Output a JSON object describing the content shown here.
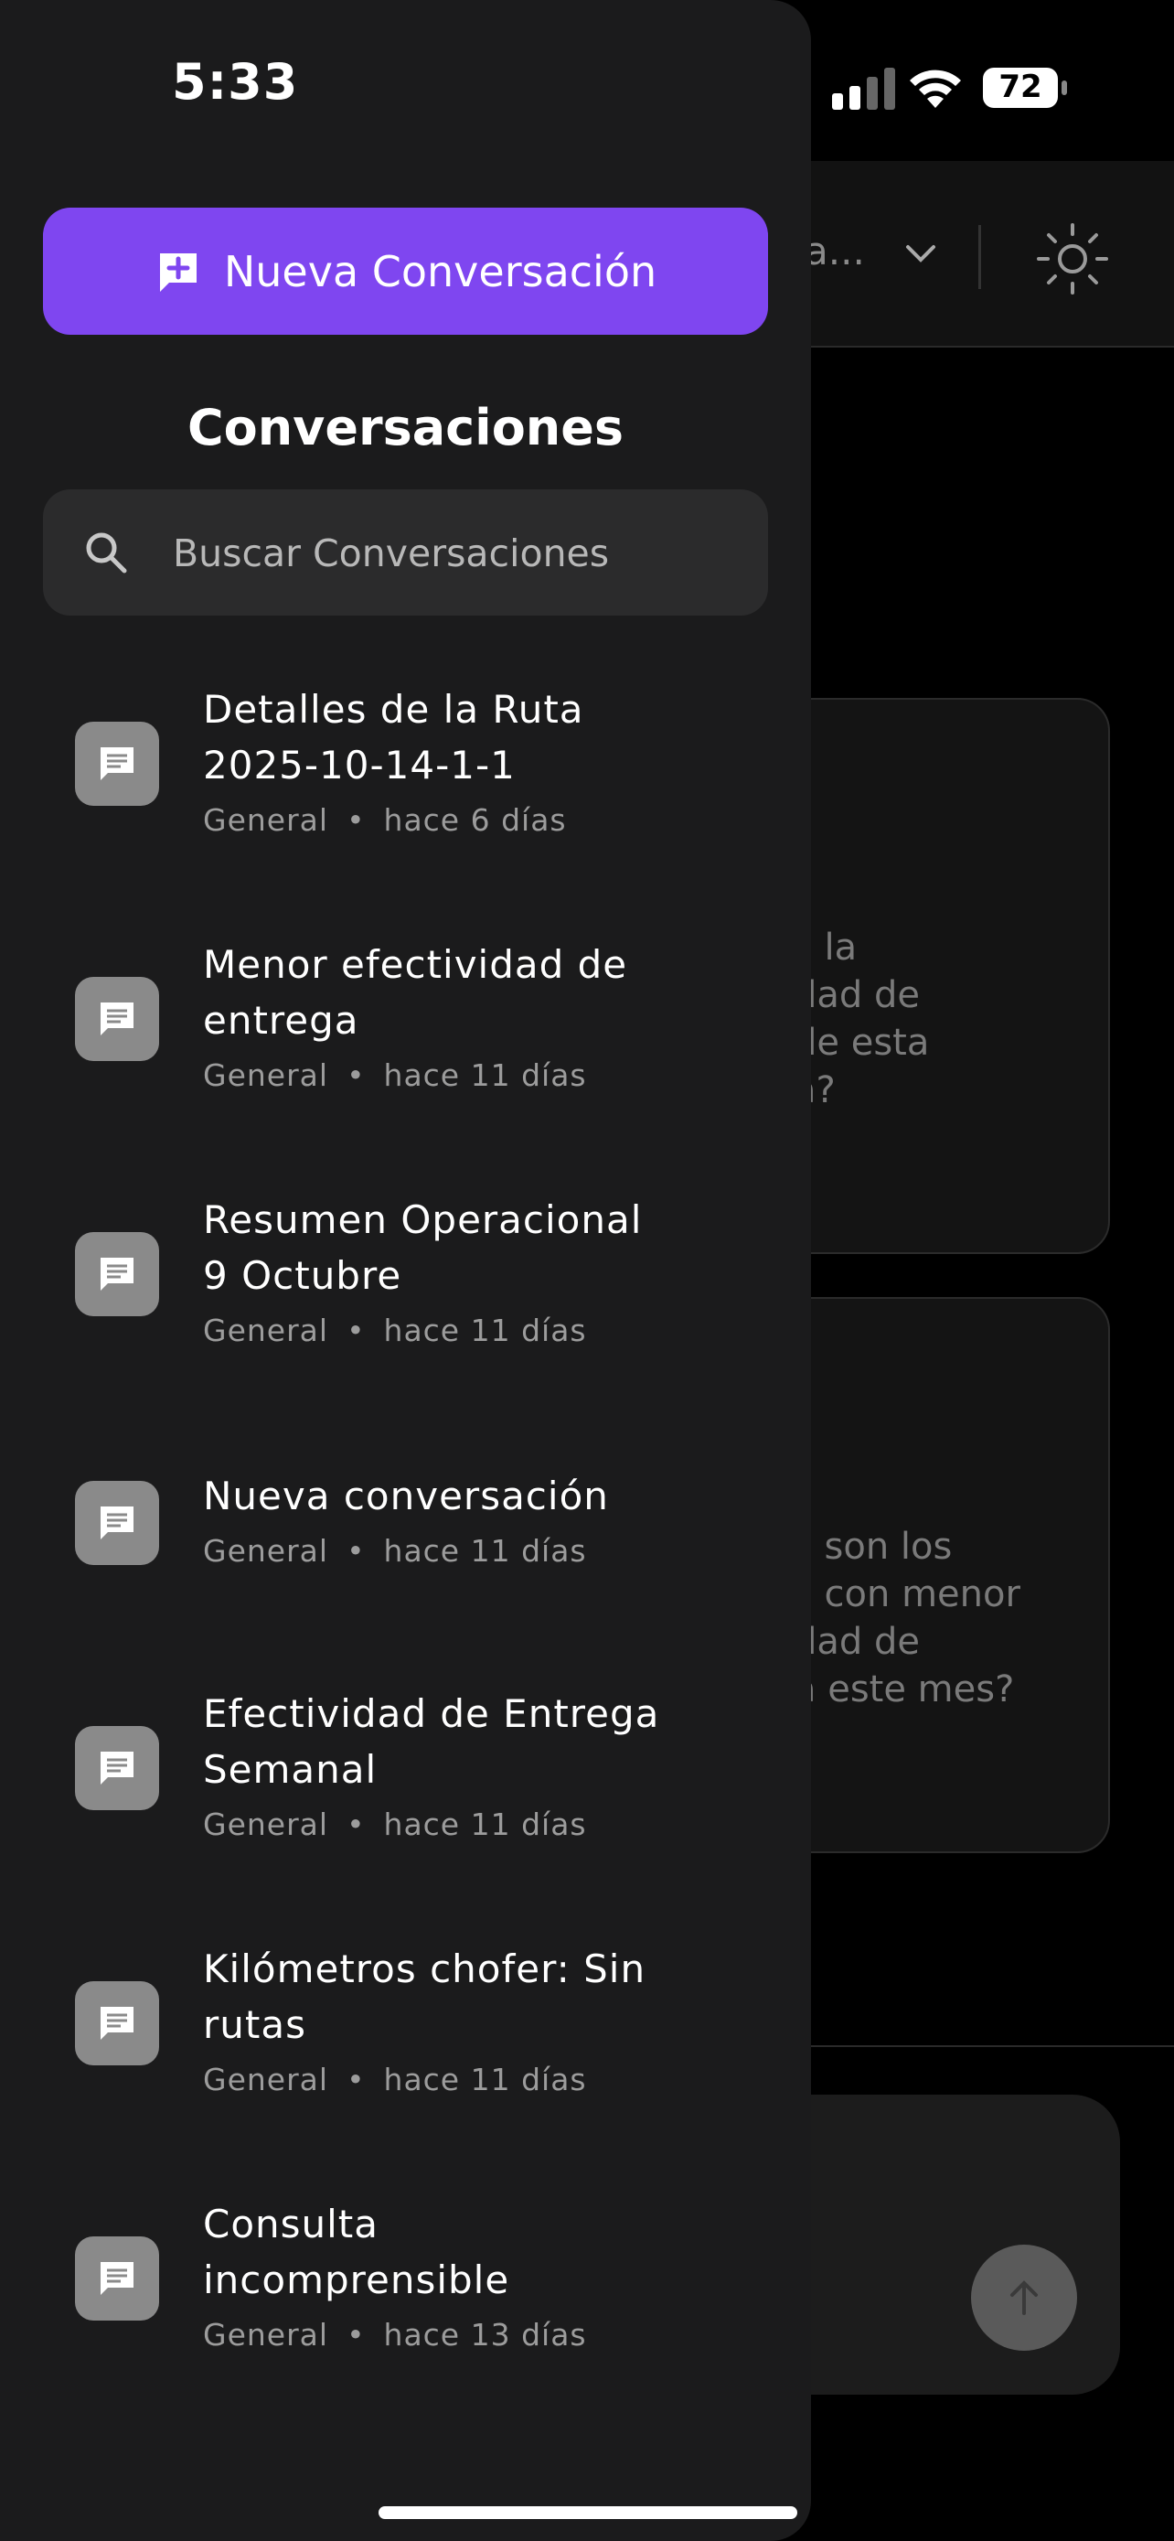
{
  "status_bar": {
    "time": "5:33",
    "battery": "72"
  },
  "background": {
    "model_selector": "a...",
    "cards": [
      {
        "lines": [
          "s la",
          "dad de",
          "de esta",
          "a?"
        ]
      },
      {
        "lines": [
          "s son los",
          "s con menor",
          "dad de",
          "a este mes?"
        ]
      }
    ]
  },
  "drawer": {
    "new_button_label": "Nueva Conversación",
    "title": "Conversaciones",
    "search_placeholder": "Buscar Conversaciones",
    "conversations": [
      {
        "title_lines": [
          "Detalles de la Ruta",
          "2025-10-14-1-1"
        ],
        "category": "General",
        "time": "hace 6 días"
      },
      {
        "title_lines": [
          "Menor efectividad de",
          "entrega"
        ],
        "category": "General",
        "time": "hace 11 días"
      },
      {
        "title_lines": [
          "Resumen Operacional",
          "9 Octubre"
        ],
        "category": "General",
        "time": "hace 11 días"
      },
      {
        "title_lines": [
          "Nueva conversación"
        ],
        "category": "General",
        "time": "hace 11 días"
      },
      {
        "title_lines": [
          "Efectividad de Entrega",
          "Semanal"
        ],
        "category": "General",
        "time": "hace 11 días"
      },
      {
        "title_lines": [
          "Kilómetros chofer: Sin",
          "rutas"
        ],
        "category": "General",
        "time": "hace 11 días"
      },
      {
        "title_lines": [
          "Consulta",
          "incomprensible"
        ],
        "category": "General",
        "time": "hace 13 días"
      }
    ],
    "meta_separator": "•"
  },
  "colors": {
    "accent": "#7f46f0",
    "drawer_bg": "#1b1b1c",
    "icon_tile": "#8a8a8a"
  }
}
